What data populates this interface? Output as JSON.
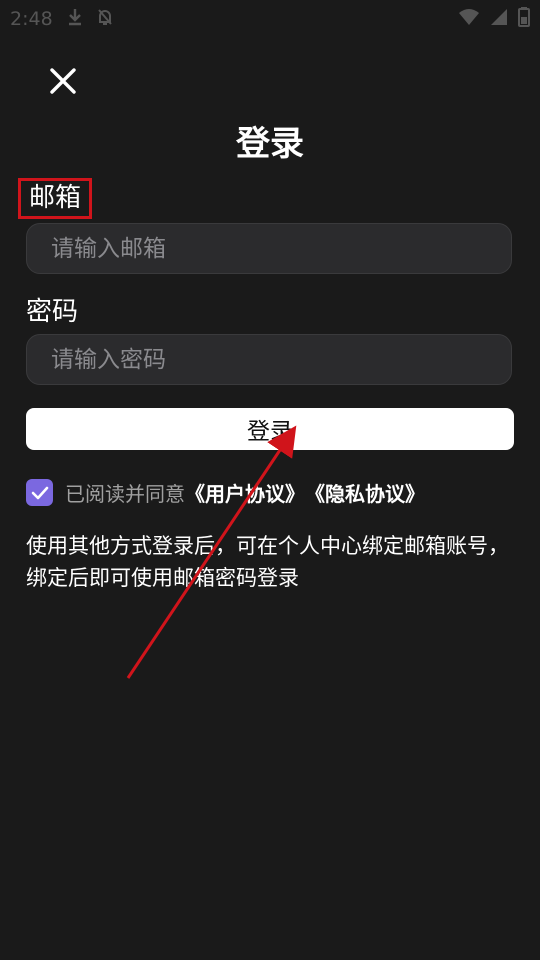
{
  "status_bar": {
    "time": "2:48",
    "icons": [
      "download-icon",
      "notification-icon",
      "wifi-icon",
      "signal-icon",
      "battery-icon"
    ]
  },
  "header": {
    "close_icon": "close-icon",
    "title": "登录"
  },
  "form": {
    "email_label": "邮箱",
    "email_placeholder": "请输入邮箱",
    "email_value": "",
    "password_label": "密码",
    "password_placeholder": "请输入密码",
    "password_value": "",
    "login_button": "登录"
  },
  "agreement": {
    "checked": true,
    "prefix": "已阅读并同意",
    "user_agreement": "《用户协议》",
    "privacy_policy": "《隐私协议》"
  },
  "tip": "使用其他方式登录后，可在个人中心绑定邮箱账号，绑定后即可使用邮箱密码登录",
  "colors": {
    "background": "#1a1a1a",
    "input_bg": "#2b2b2d",
    "accent": "#7b68e0",
    "annotation": "#d0141b"
  }
}
